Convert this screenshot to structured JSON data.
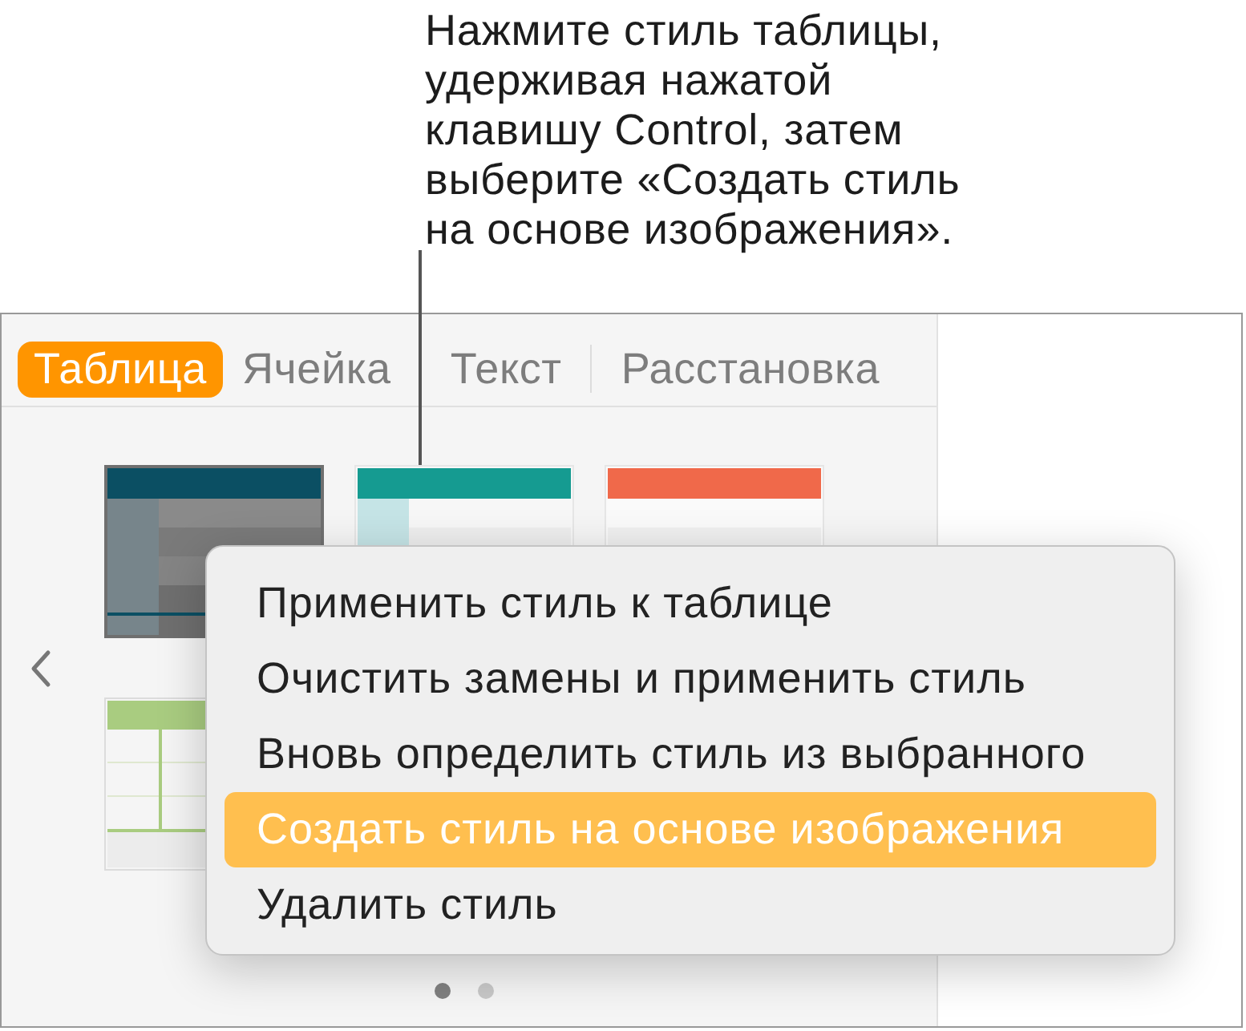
{
  "callout": {
    "text": "Нажмите стиль таблицы,\nудерживая нажатой\nклавишу Control, затем\nвыберите «Создать стиль\nна основе изображения»."
  },
  "tabs": [
    {
      "label": "Таблица",
      "selected": true
    },
    {
      "label": "Ячейка",
      "selected": false
    },
    {
      "label": "Текст",
      "selected": false
    },
    {
      "label": "Расстановка",
      "selected": false
    }
  ],
  "table_styles": [
    {
      "kind": "dark",
      "color": "#0b4f63"
    },
    {
      "kind": "banded",
      "color": "#159b91"
    },
    {
      "kind": "plain",
      "color": "#f0694a"
    },
    {
      "kind": "grid",
      "color": "#a9cc80"
    }
  ],
  "page_dots": [
    {
      "selected": true
    },
    {
      "selected": false
    }
  ],
  "context_menu": {
    "items": [
      {
        "label": "Применить стиль к таблице",
        "selected": false
      },
      {
        "label": "Очистить замены и применить стиль",
        "selected": false
      },
      {
        "label": "Вновь определить стиль из выбранного",
        "selected": false
      },
      {
        "label": "Создать стиль на основе изображения",
        "selected": true
      },
      {
        "label": "Удалить стиль",
        "selected": false
      }
    ]
  }
}
